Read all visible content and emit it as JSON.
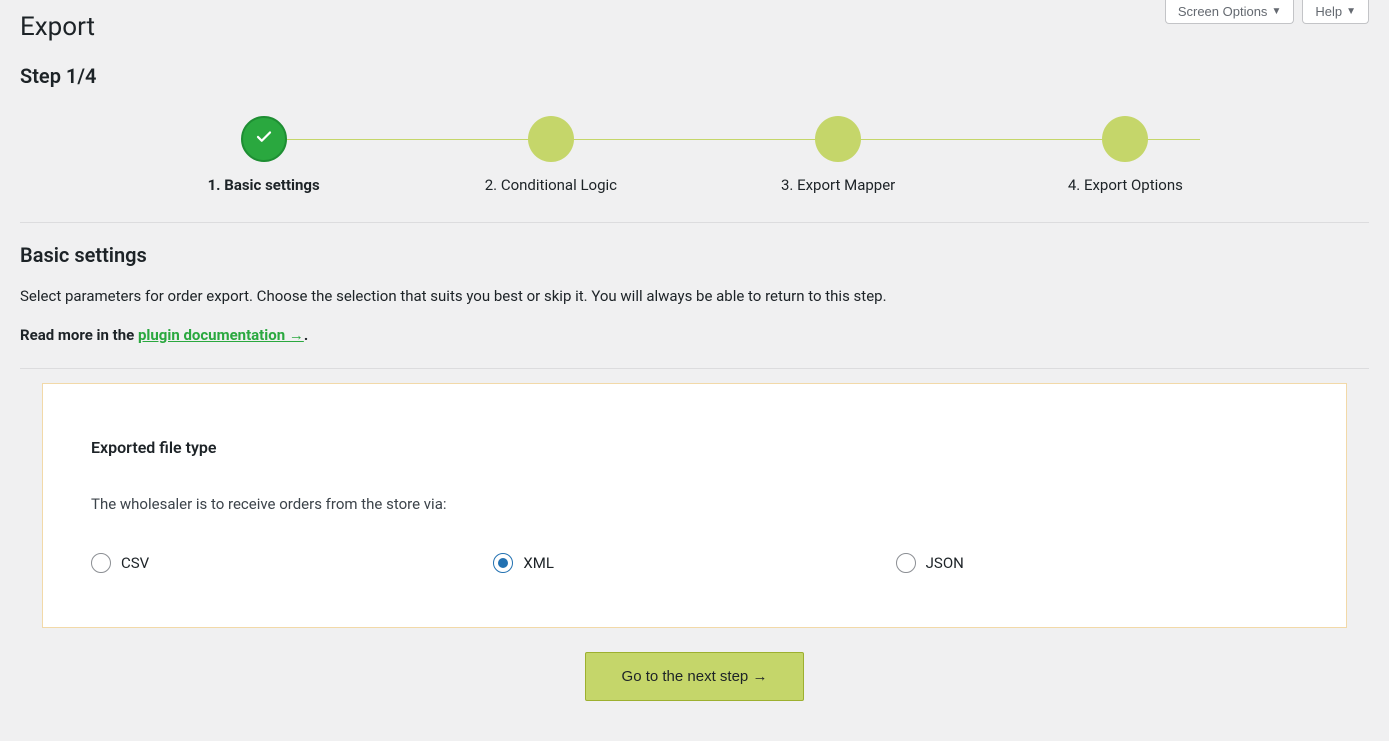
{
  "top": {
    "screen_options": "Screen Options",
    "help": "Help"
  },
  "page_title": "Export",
  "step_heading": "Step 1/4",
  "stepper": {
    "steps": [
      {
        "label": "1. Basic settings",
        "active": true
      },
      {
        "label": "2. Conditional Logic",
        "active": false
      },
      {
        "label": "3. Export Mapper",
        "active": false
      },
      {
        "label": "4. Export Options",
        "active": false
      }
    ]
  },
  "section": {
    "title": "Basic settings",
    "desc": "Select parameters for order export. Choose the selection that suits you best or skip it. You will always be able to return to this step.",
    "doc_prefix": "Read more in the ",
    "doc_link": "plugin documentation →",
    "doc_suffix": "."
  },
  "panel": {
    "title": "Exported file type",
    "desc": "The wholesaler is to receive orders from the store via:",
    "options": {
      "csv": "CSV",
      "xml": "XML",
      "json": "JSON"
    },
    "selected": "xml"
  },
  "next_button": "Go to the next step →"
}
